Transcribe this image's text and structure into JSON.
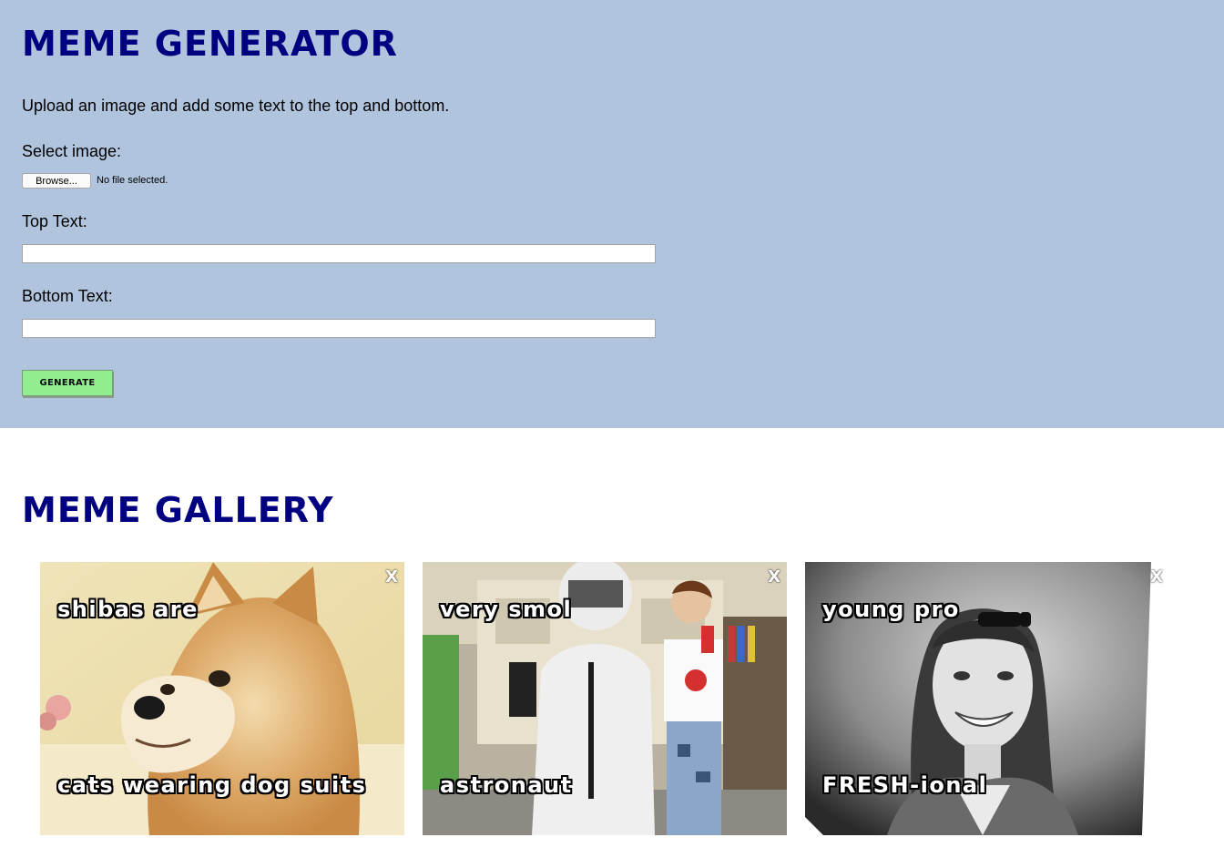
{
  "generator": {
    "title": "Meme Generator",
    "intro": "Upload an image and add some text to the top and bottom.",
    "select_image_label": "Select image:",
    "browse_label": "Browse...",
    "file_status": "No file selected.",
    "top_text_label": "Top Text:",
    "top_text_value": "",
    "bottom_text_label": "Bottom Text:",
    "bottom_text_value": "",
    "generate_label": "Generate",
    "background_color": "#b0c4de",
    "title_color": "#000080",
    "generate_color": "#90ee90"
  },
  "gallery": {
    "title": "Meme Gallery",
    "close_label": "X",
    "memes": [
      {
        "top_text": "shibas are",
        "bottom_text": "cats wearing dog suits",
        "image": "shiba-dog-photo"
      },
      {
        "top_text": "very smol",
        "bottom_text": "astronaut",
        "image": "child-astronaut-costume-photo"
      },
      {
        "top_text": "young pro",
        "bottom_text": "FRESH-ional",
        "image": "smiling-woman-bw-photo"
      }
    ]
  }
}
